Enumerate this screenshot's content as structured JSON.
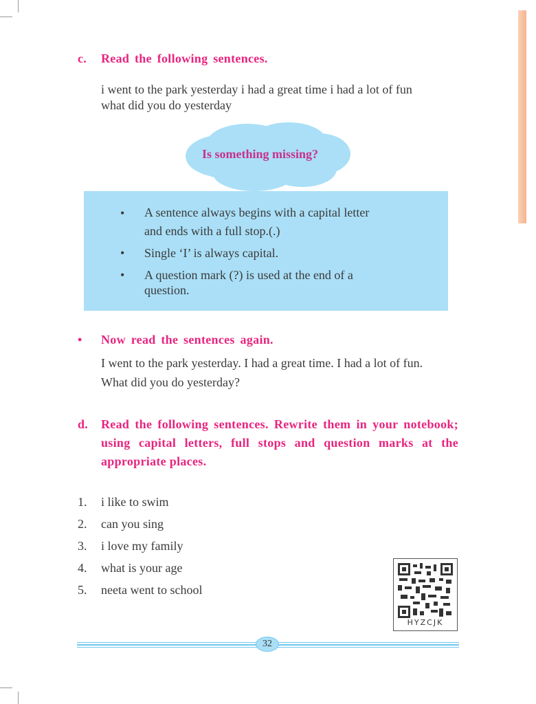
{
  "colors": {
    "heading": "#e8247f",
    "box": "#aadff7",
    "text": "#3a3a3a"
  },
  "section_c": {
    "label": "c.",
    "heading": "Read the following sentences.",
    "lines": [
      "i went to the park yesterday i had a great time i had a lot of fun",
      "what did you do yesterday"
    ],
    "cloud_text": "Is something missing?",
    "rules": [
      {
        "lines": [
          "A sentence always begins with a capital letter",
          "and ends with a full stop.(.)"
        ]
      },
      {
        "lines": [
          "Single ‘I’ is always capital."
        ]
      },
      {
        "lines": [
          "A question mark (?) is used at the end of a",
          "question."
        ]
      }
    ],
    "bullet": "•",
    "again_heading": "Now read the sentences again.",
    "again_lines": [
      "I went to the park yesterday. I had a great time. I had a lot of fun.",
      "What did you do yesterday?"
    ]
  },
  "section_d": {
    "label": "d.",
    "heading_lines": [
      "Read the following sentences. Rewrite them in your notebook;",
      "using capital letters, full stops and question marks at the",
      "appropriate places."
    ],
    "items": [
      {
        "num": "1.",
        "text": "i like to swim"
      },
      {
        "num": "2.",
        "text": "can you sing"
      },
      {
        "num": "3.",
        "text": "i love my family"
      },
      {
        "num": "4.",
        "text": "what is your age"
      },
      {
        "num": "5.",
        "text": "neeta went to school"
      }
    ]
  },
  "qr": {
    "code": "HYZCJK",
    "icon": "qr-code-icon"
  },
  "page_number": "32"
}
